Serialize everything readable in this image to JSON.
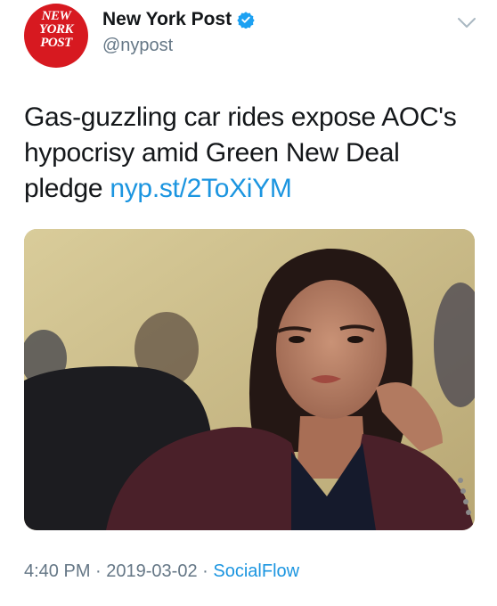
{
  "account": {
    "avatar_logo_lines": [
      "NEW",
      "YORK",
      "POST"
    ],
    "display_name": "New York Post",
    "handle": "@nypost",
    "verified": true
  },
  "tweet": {
    "text": "Gas-guzzling car rides expose AOC's hypocrisy amid Green New Deal pledge",
    "link_text": "nyp.st/2ToXiYM"
  },
  "media": {
    "kind": "photo"
  },
  "meta": {
    "time": "4:40 PM",
    "separator": "·",
    "date": "2019-03-02",
    "source": "SocialFlow"
  },
  "colors": {
    "accent_blue": "#1b95e0",
    "secondary_text": "#657786",
    "brand_red": "#d71920"
  },
  "icons": {
    "verified": "verified-badge-icon",
    "menu": "chevron-down-icon"
  }
}
